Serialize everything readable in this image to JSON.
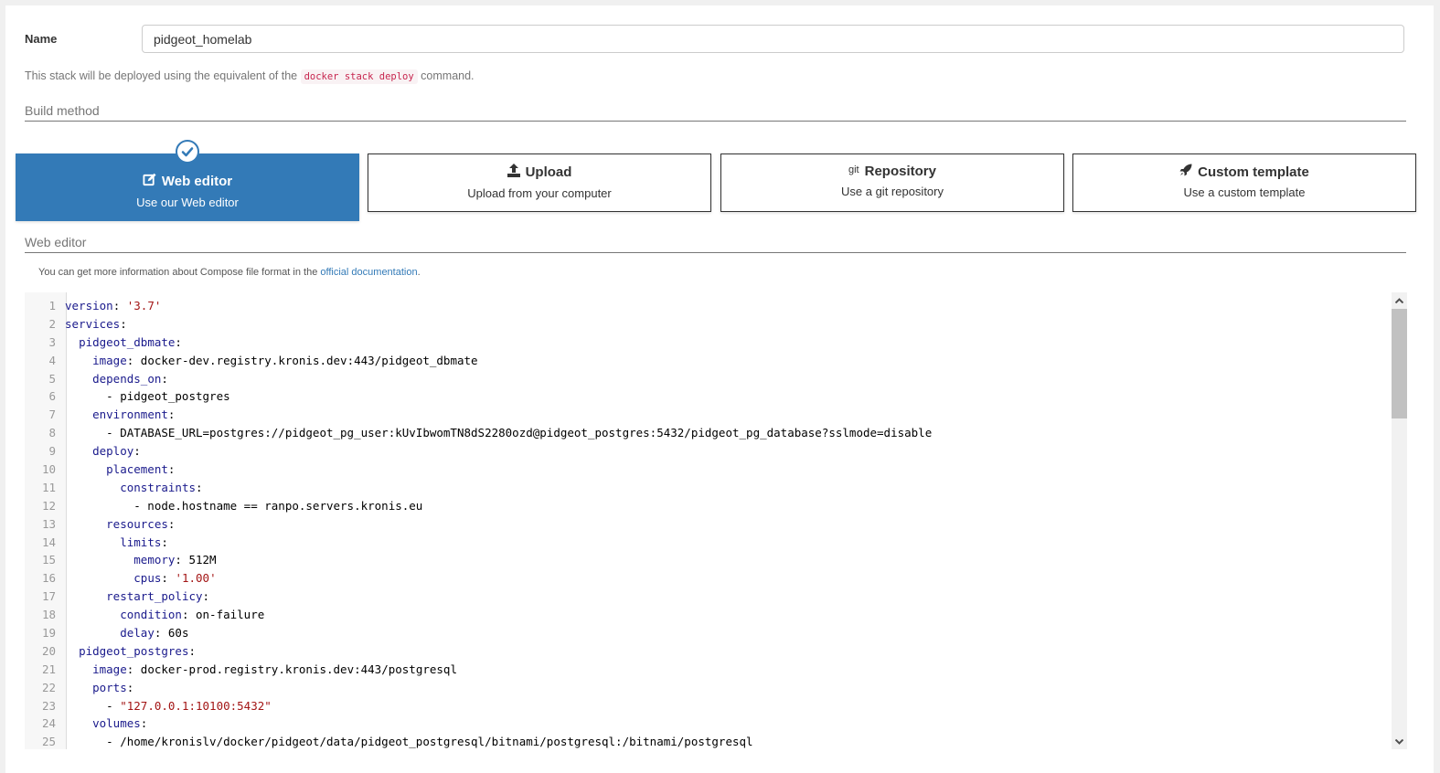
{
  "form": {
    "name_label": "Name",
    "name_value": "pidgeot_homelab",
    "deploy_hint_before": "This stack will be deployed using the equivalent of the ",
    "deploy_hint_code": "docker stack deploy",
    "deploy_hint_after": " command."
  },
  "build_method": {
    "section_title": "Build method",
    "options": [
      {
        "icon": "edit-icon",
        "title": "Web editor",
        "subtitle": "Use our Web editor",
        "selected": true
      },
      {
        "icon": "upload-icon",
        "title": "Upload",
        "subtitle": "Upload from your computer",
        "selected": false
      },
      {
        "icon": "git-icon",
        "title": "Repository",
        "subtitle": "Use a git repository",
        "selected": false
      },
      {
        "icon": "rocket-icon",
        "title": "Custom template",
        "subtitle": "Use a custom template",
        "selected": false
      }
    ],
    "git_glyph": "git"
  },
  "web_editor": {
    "section_title": "Web editor",
    "info_before": "You can get more information about Compose file format in the ",
    "info_link": "official documentation",
    "info_after": ".",
    "lines": [
      [
        {
          "t": "k",
          "v": "version"
        },
        {
          "t": "p",
          "v": ": "
        },
        {
          "t": "s",
          "v": "'3.7'"
        }
      ],
      [
        {
          "t": "k",
          "v": "services"
        },
        {
          "t": "p",
          "v": ":"
        }
      ],
      [
        {
          "t": "p",
          "v": "  "
        },
        {
          "t": "k",
          "v": "pidgeot_dbmate"
        },
        {
          "t": "p",
          "v": ":"
        }
      ],
      [
        {
          "t": "p",
          "v": "    "
        },
        {
          "t": "k",
          "v": "image"
        },
        {
          "t": "p",
          "v": ": docker-dev.registry.kronis.dev:443/pidgeot_dbmate"
        }
      ],
      [
        {
          "t": "p",
          "v": "    "
        },
        {
          "t": "k",
          "v": "depends_on"
        },
        {
          "t": "p",
          "v": ":"
        }
      ],
      [
        {
          "t": "p",
          "v": "      - pidgeot_postgres"
        }
      ],
      [
        {
          "t": "p",
          "v": "    "
        },
        {
          "t": "k",
          "v": "environment"
        },
        {
          "t": "p",
          "v": ":"
        }
      ],
      [
        {
          "t": "p",
          "v": "      - DATABASE_URL=postgres://pidgeot_pg_user:kUvIbwomTN8dS2280ozd@pidgeot_postgres:5432/pidgeot_pg_database?sslmode=disable"
        }
      ],
      [
        {
          "t": "p",
          "v": "    "
        },
        {
          "t": "k",
          "v": "deploy"
        },
        {
          "t": "p",
          "v": ":"
        }
      ],
      [
        {
          "t": "p",
          "v": "      "
        },
        {
          "t": "k",
          "v": "placement"
        },
        {
          "t": "p",
          "v": ":"
        }
      ],
      [
        {
          "t": "p",
          "v": "        "
        },
        {
          "t": "k",
          "v": "constraints"
        },
        {
          "t": "p",
          "v": ":"
        }
      ],
      [
        {
          "t": "p",
          "v": "          - node.hostname == ranpo.servers.kronis.eu"
        }
      ],
      [
        {
          "t": "p",
          "v": "      "
        },
        {
          "t": "k",
          "v": "resources"
        },
        {
          "t": "p",
          "v": ":"
        }
      ],
      [
        {
          "t": "p",
          "v": "        "
        },
        {
          "t": "k",
          "v": "limits"
        },
        {
          "t": "p",
          "v": ":"
        }
      ],
      [
        {
          "t": "p",
          "v": "          "
        },
        {
          "t": "k",
          "v": "memory"
        },
        {
          "t": "p",
          "v": ": 512M"
        }
      ],
      [
        {
          "t": "p",
          "v": "          "
        },
        {
          "t": "k",
          "v": "cpus"
        },
        {
          "t": "p",
          "v": ": "
        },
        {
          "t": "s",
          "v": "'1.00'"
        }
      ],
      [
        {
          "t": "p",
          "v": "      "
        },
        {
          "t": "k",
          "v": "restart_policy"
        },
        {
          "t": "p",
          "v": ":"
        }
      ],
      [
        {
          "t": "p",
          "v": "        "
        },
        {
          "t": "k",
          "v": "condition"
        },
        {
          "t": "p",
          "v": ": on-failure"
        }
      ],
      [
        {
          "t": "p",
          "v": "        "
        },
        {
          "t": "k",
          "v": "delay"
        },
        {
          "t": "p",
          "v": ": 60s"
        }
      ],
      [
        {
          "t": "p",
          "v": "  "
        },
        {
          "t": "k",
          "v": "pidgeot_postgres"
        },
        {
          "t": "p",
          "v": ":"
        }
      ],
      [
        {
          "t": "p",
          "v": "    "
        },
        {
          "t": "k",
          "v": "image"
        },
        {
          "t": "p",
          "v": ": docker-prod.registry.kronis.dev:443/postgresql"
        }
      ],
      [
        {
          "t": "p",
          "v": "    "
        },
        {
          "t": "k",
          "v": "ports"
        },
        {
          "t": "p",
          "v": ":"
        }
      ],
      [
        {
          "t": "p",
          "v": "      - "
        },
        {
          "t": "s",
          "v": "\"127.0.0.1:10100:5432\""
        }
      ],
      [
        {
          "t": "p",
          "v": "    "
        },
        {
          "t": "k",
          "v": "volumes"
        },
        {
          "t": "p",
          "v": ":"
        }
      ],
      [
        {
          "t": "p",
          "v": "      - /home/kronislv/docker/pidgeot/data/pidgeot_postgresql/bitnami/postgresql:/bitnami/postgresql"
        }
      ]
    ]
  },
  "colors": {
    "accent": "#337ab7",
    "code_key": "#1a1a8c",
    "code_string": "#a31515",
    "inline_code": "#c7254e"
  }
}
